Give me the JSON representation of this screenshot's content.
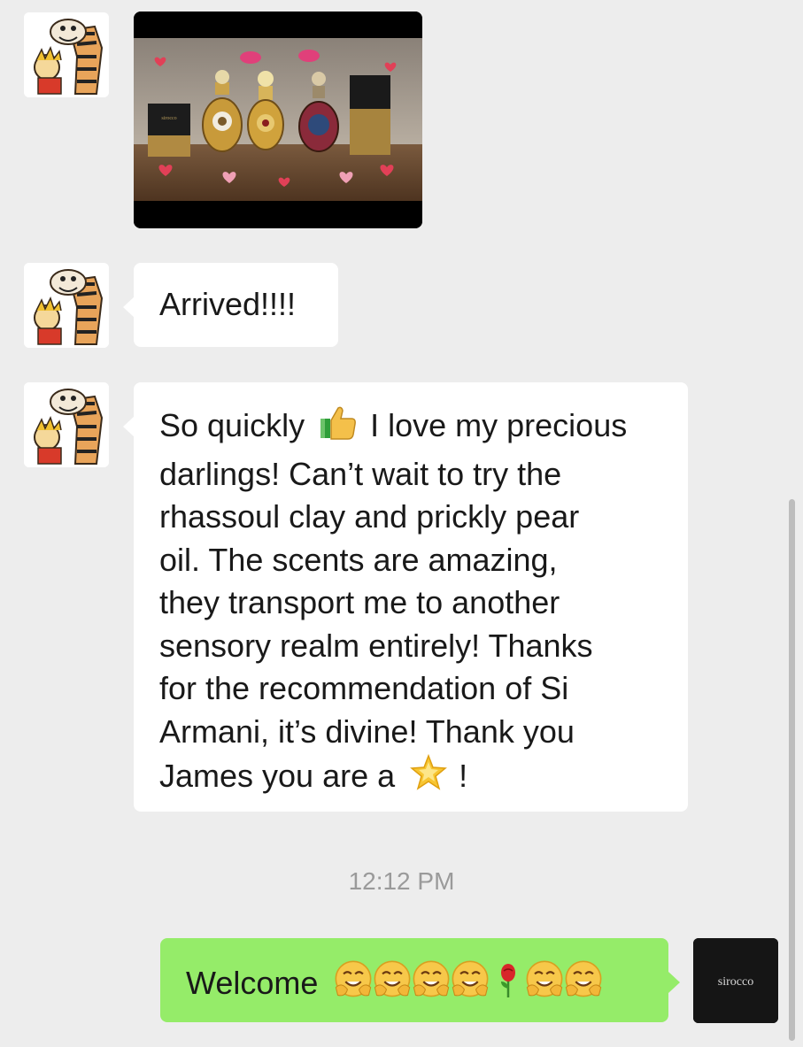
{
  "chat": {
    "messages": [
      {
        "type": "image",
        "sender": "contact",
        "image_description_icon": "perfume-bottles-photo"
      },
      {
        "type": "text",
        "sender": "contact",
        "text": "Arrived!!!!"
      },
      {
        "type": "text",
        "sender": "contact",
        "lines": [
          "So quickly",
          "I love my precious",
          "darlings! Can’t wait to try the",
          "rhassoul clay and prickly pear",
          "oil. The scents are amazing,",
          "they transport me to another",
          "sensory realm entirely! Thanks",
          "for the recommendation of Si",
          "Armani, it’s divine! Thank you",
          "James you are a",
          "!"
        ]
      }
    ],
    "timestamp": "12:12 PM",
    "reply": {
      "sender": "self",
      "text": "Welcome",
      "emojis": [
        "hug",
        "hug",
        "hug",
        "hug",
        "rose",
        "hug",
        "hug"
      ]
    },
    "self_avatar_text": "sirocco",
    "product_box_text": "sirocco"
  },
  "colors": {
    "background": "#ededed",
    "incoming_bubble": "#ffffff",
    "outgoing_bubble": "#95ec69",
    "timestamp": "#9a9a9a"
  }
}
